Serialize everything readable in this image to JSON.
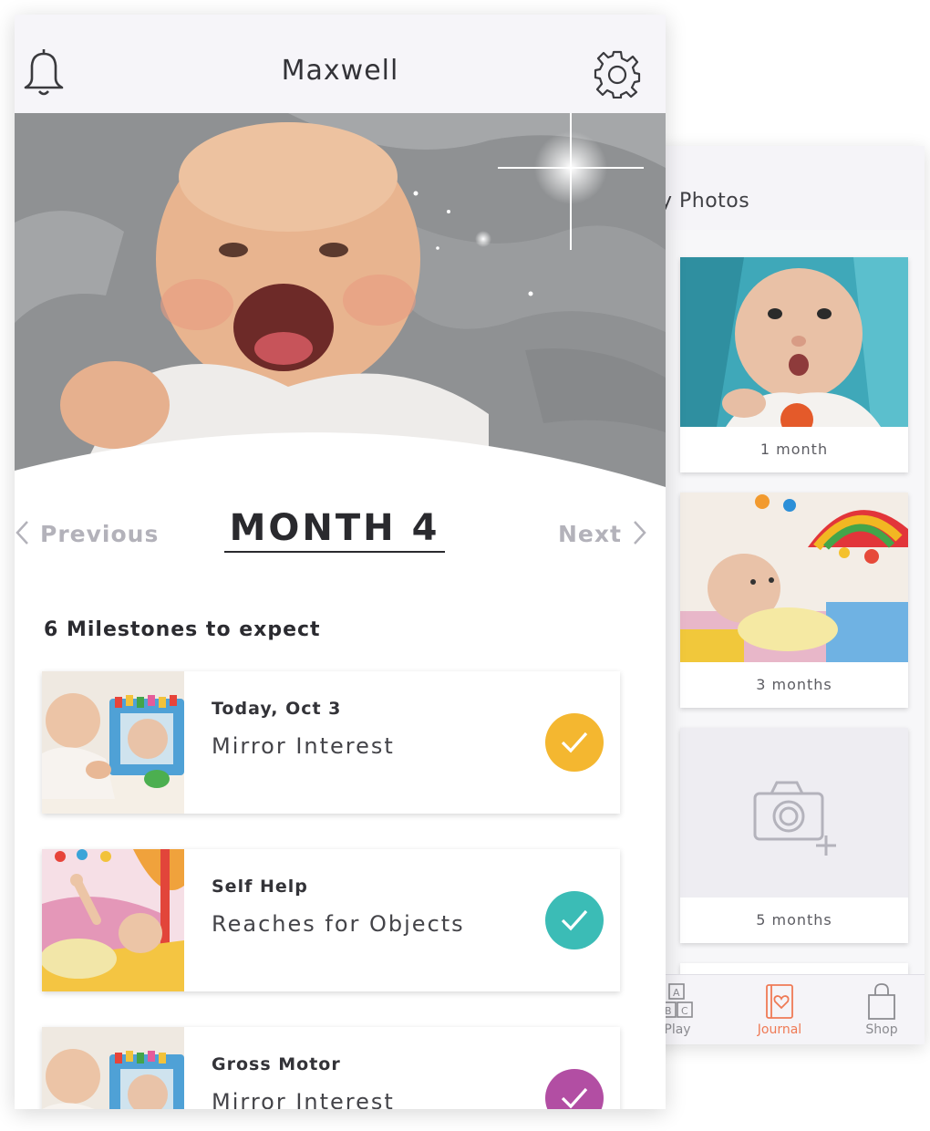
{
  "front": {
    "header": {
      "title": "Maxwell"
    },
    "nav": {
      "previous_label": "Previous",
      "month_title": "MONTH 4",
      "next_label": "Next"
    },
    "milestones_heading": "6 Milestones to expect",
    "milestones": [
      {
        "category": "Today, Oct 3",
        "name": "Mirror Interest",
        "check_color": "#f4b730"
      },
      {
        "category": "Self Help",
        "name": "Reaches for Objects",
        "check_color": "#3bbcb6"
      },
      {
        "category": "Gross Motor",
        "name": "Mirror Interest",
        "check_color": "#b24ea3"
      }
    ]
  },
  "back": {
    "header": {
      "title": "y Photos"
    },
    "photos": [
      {
        "caption": "1 month"
      },
      {
        "caption": "3 months"
      },
      {
        "caption": "5 months"
      }
    ],
    "tabs": [
      {
        "label": "Play",
        "icon": "abc-blocks-icon",
        "active": false
      },
      {
        "label": "Journal",
        "icon": "journal-heart-icon",
        "active": true
      },
      {
        "label": "Shop",
        "icon": "shopping-bag-icon",
        "active": false
      }
    ]
  },
  "colors": {
    "accent": "#ef7a55",
    "header_bg": "#f6f5f9"
  }
}
